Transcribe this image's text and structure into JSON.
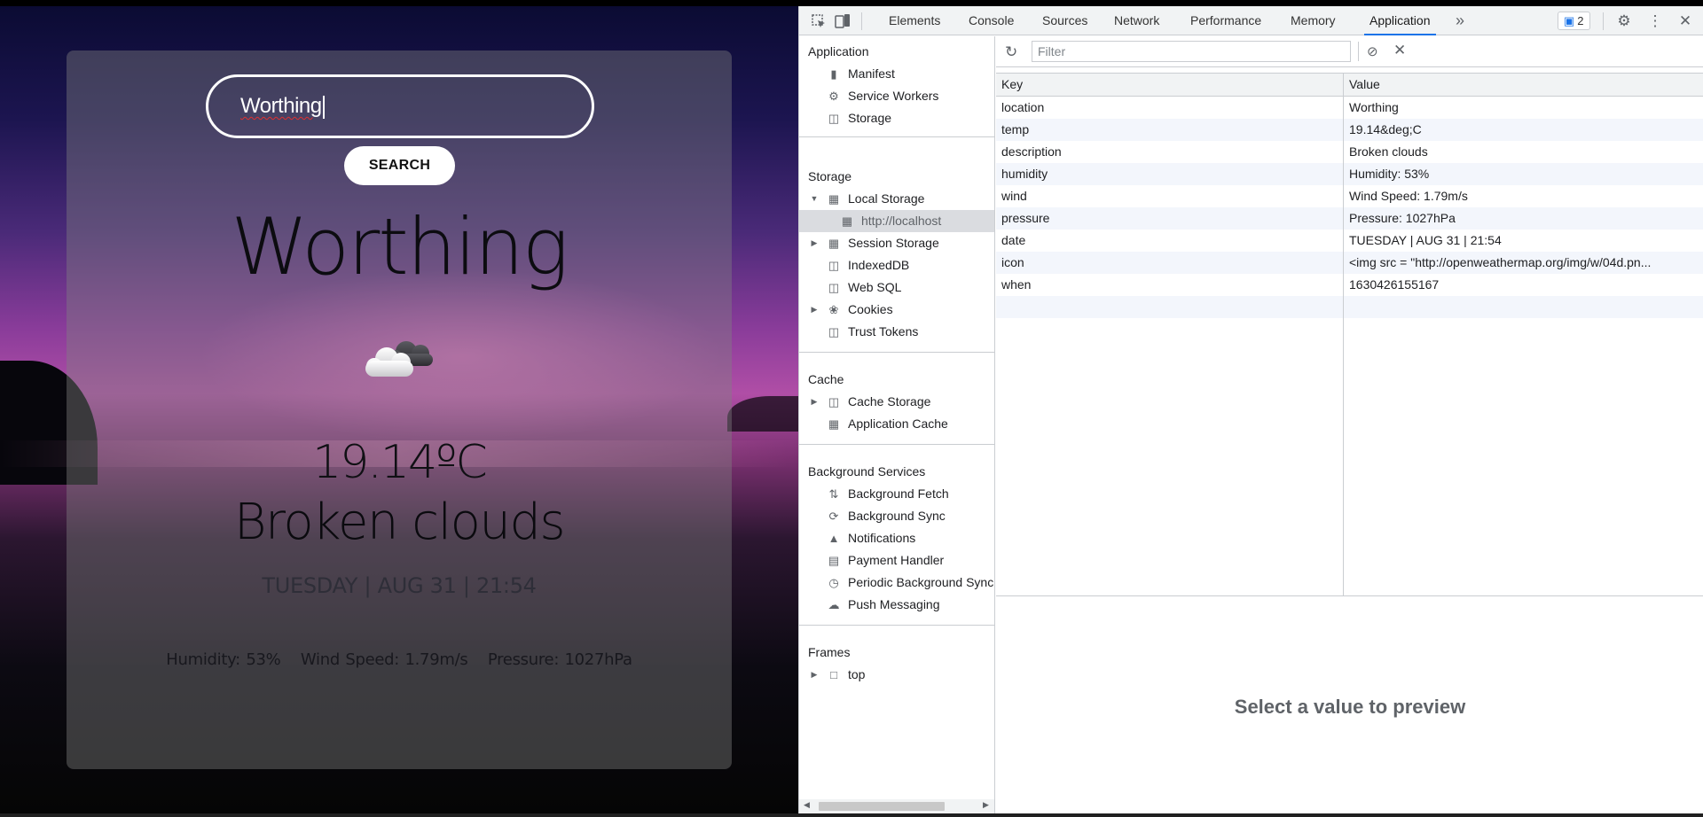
{
  "weather_app": {
    "search_value": "Worthing",
    "search_button": "SEARCH",
    "city": "Worthing",
    "icon": "broken-clouds-icon",
    "temp": "19.14ºC",
    "description": "Broken clouds",
    "date": "TUESDAY | AUG 31 | 21:54",
    "humidity": "Humidity: 53%",
    "wind": "Wind Speed: 1.79m/s",
    "pressure": "Pressure: 1027hPa"
  },
  "devtools": {
    "toolbar": {
      "tabs": [
        "Elements",
        "Console",
        "Sources",
        "Network",
        "Performance",
        "Memory",
        "Application"
      ],
      "active_tab": "Application",
      "more_tabs": "»",
      "issues_count": "2"
    },
    "sidebar": {
      "application_title": "Application",
      "application_items": [
        "Manifest",
        "Service Workers",
        "Storage"
      ],
      "storage_title": "Storage",
      "storage_items": [
        "Local Storage",
        "http://localhost",
        "Session Storage",
        "IndexedDB",
        "Web SQL",
        "Cookies",
        "Trust Tokens"
      ],
      "cache_title": "Cache",
      "cache_items": [
        "Cache Storage",
        "Application Cache"
      ],
      "bg_title": "Background Services",
      "bg_items": [
        "Background Fetch",
        "Background Sync",
        "Notifications",
        "Payment Handler",
        "Periodic Background Sync",
        "Push Messaging"
      ],
      "frames_title": "Frames",
      "frames_items": [
        "top"
      ]
    },
    "filter_placeholder": "Filter",
    "table": {
      "headers": [
        "Key",
        "Value"
      ],
      "rows": [
        {
          "key": "location",
          "value": "Worthing"
        },
        {
          "key": "temp",
          "value": "19.14&deg;C"
        },
        {
          "key": "description",
          "value": "Broken clouds"
        },
        {
          "key": "humidity",
          "value": "Humidity: 53%"
        },
        {
          "key": "wind",
          "value": "Wind Speed: 1.79m/s"
        },
        {
          "key": "pressure",
          "value": "Pressure: 1027hPa"
        },
        {
          "key": "date",
          "value": "TUESDAY | AUG 31 | 21:54"
        },
        {
          "key": "icon",
          "value": "<img src = \"http://openweathermap.org/img/w/04d.pn..."
        },
        {
          "key": "when",
          "value": "1630426155167"
        }
      ]
    },
    "preview_text": "Select a value to preview"
  }
}
